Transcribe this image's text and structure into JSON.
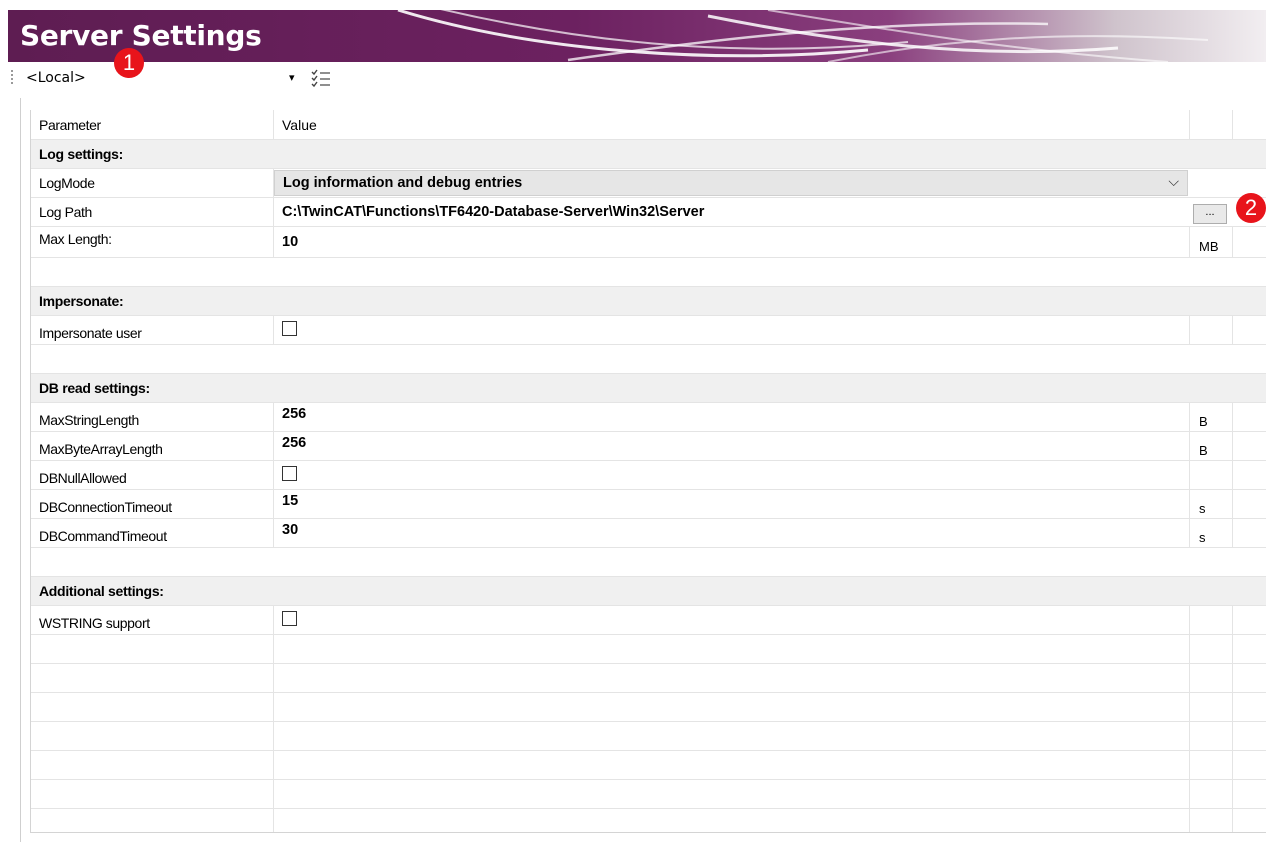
{
  "window": {
    "title": "Server Settings"
  },
  "toolbar": {
    "server_selected": "<Local>",
    "dropdown_arrow": "▾",
    "settings_icon": "checklist-icon"
  },
  "badges": {
    "first": "1",
    "second": "2"
  },
  "grid": {
    "header": {
      "parameter": "Parameter",
      "value": "Value"
    },
    "log_settings": {
      "title": "Log settings:",
      "log_mode": {
        "label": "LogMode",
        "value": "Log information and debug entries"
      },
      "log_path": {
        "label": "Log Path",
        "value": "C:\\TwinCAT\\Functions\\TF6420-Database-Server\\Win32\\Server",
        "browse": "..."
      },
      "max_length": {
        "label": " Max Length:",
        "value": "10",
        "unit": "MB"
      }
    },
    "impersonate": {
      "title": "Impersonate:",
      "impersonate_user": {
        "label": "Impersonate user",
        "checked": false
      }
    },
    "db_read": {
      "title": "DB read settings:",
      "max_string_length": {
        "label": "MaxStringLength",
        "value": "256",
        "unit": "B"
      },
      "max_byte_array_length": {
        "label": "MaxByteArrayLength",
        "value": "256",
        "unit": "B"
      },
      "db_null_allowed": {
        "label": "DBNullAllowed",
        "checked": false
      },
      "db_connection_timeout": {
        "label": "DBConnectionTimeout",
        "value": "15",
        "unit": "s"
      },
      "db_command_timeout": {
        "label": "DBCommandTimeout",
        "value": "30",
        "unit": "s"
      }
    },
    "additional": {
      "title": "Additional settings:",
      "wstring_support": {
        "label": "WSTRING support",
        "checked": false
      }
    }
  },
  "colors": {
    "title_bar": "#6c2160",
    "badge": "#e8141b",
    "section_bg": "#f0f0f0"
  }
}
